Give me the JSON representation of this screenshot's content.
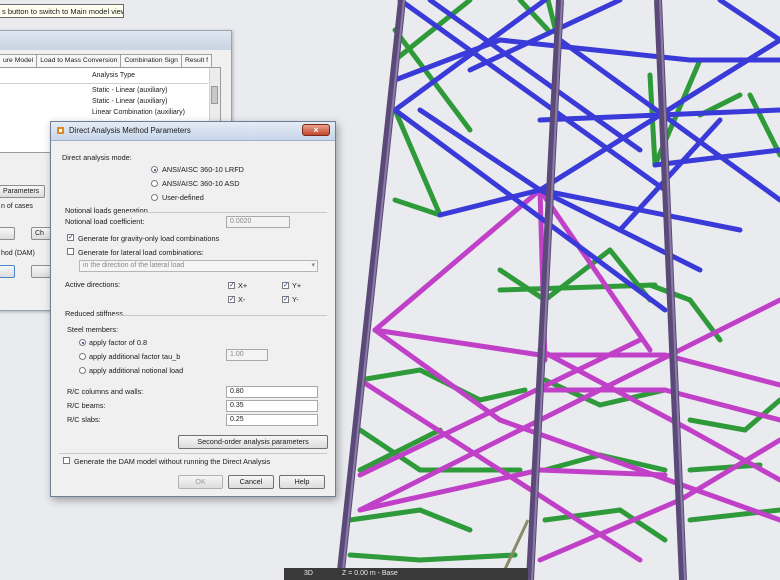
{
  "tooltip": {
    "text": "s button to switch to Main model view.)"
  },
  "background_window": {
    "tabs": [
      "ure Model",
      "Load to Mass Conversion",
      "Combination Sign",
      "Result f"
    ],
    "list_header": "Analysis Type",
    "list_rows": [
      "Static - Linear (auxiliary)",
      "Static - Linear (auxiliary)",
      "Linear Combination (auxiliary)"
    ],
    "params_button": "Parameters",
    "cases_text": "n of cases",
    "ch_button": "Ch",
    "dam_text": "hod (DAM)"
  },
  "dialog": {
    "title": "Direct Analysis Method Parameters",
    "mode_label": "Direct analysis mode:",
    "mode_options": [
      "ANSI/AISC 360-10 LRFD",
      "ANSI/AISC 360-10 ASD",
      "User-defined"
    ],
    "mode_selected": 0,
    "notional_heading": "Notional loads generation",
    "notional_coef_label": "Notional load coefficient:",
    "notional_coef_value": "0.0020",
    "gen_gravity_label": "Generate for gravity-only load combinations",
    "gen_gravity_checked": true,
    "gen_lateral_label": "Generate for lateral load combinations:",
    "gen_lateral_checked": false,
    "lateral_direction": "in the direction of the lateral load",
    "active_dir_label": "Active directions:",
    "directions": [
      "X+",
      "Y+",
      "X-",
      "Y-"
    ],
    "reduced_heading": "Reduced stiffness",
    "steel_label": "Steel members:",
    "steel_options": [
      "apply factor of 0.8",
      "apply additional factor tau_b",
      "apply additional notional load"
    ],
    "steel_selected": 0,
    "tau_value": "1.00",
    "rc_columns_label": "R/C columns and walls:",
    "rc_columns_value": "0.80",
    "rc_beams_label": "R/C beams:",
    "rc_beams_value": "0.35",
    "rc_slabs_label": "R/C slabs:",
    "rc_slabs_value": "0.25",
    "second_order_button": "Second-order analysis parameters",
    "generate_only_label": "Generate the DAM model without running the Direct Analysis",
    "ok": "OK",
    "cancel": "Cancel",
    "help": "Help"
  },
  "status_bar": {
    "view": "3D",
    "level": "Z = 0.00 m - Base"
  },
  "colors": {
    "viewport_bg": "#e9ebef",
    "column": "#5b4a78",
    "blue_bracing": "#3a3ad8",
    "green_bracing": "#2f9a3a",
    "magenta_bracing": "#c040c8"
  }
}
